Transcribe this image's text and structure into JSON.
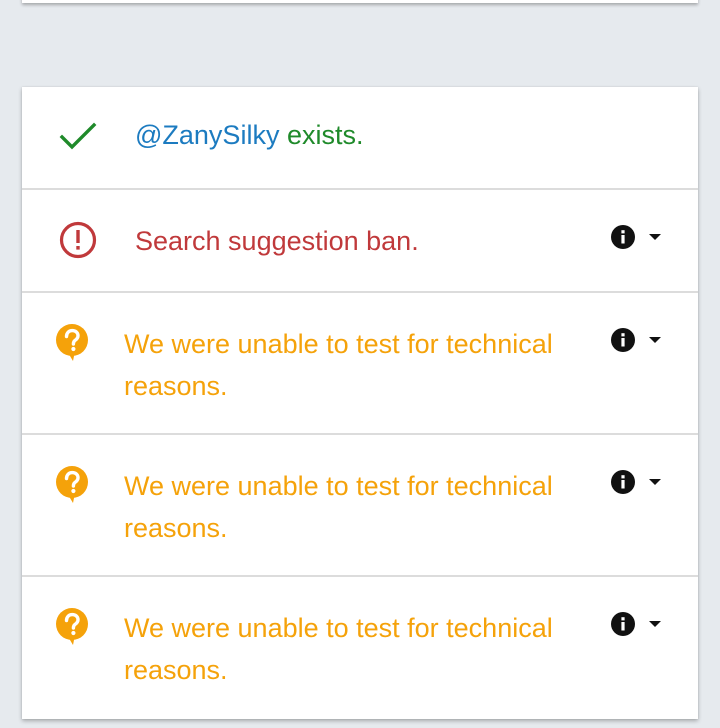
{
  "colors": {
    "background": "#e6eaee",
    "card": "#ffffff",
    "divider": "#dcdcdc",
    "success": "#1f8a2a",
    "handle": "#1c7bc0",
    "error": "#c0393b",
    "warning": "#f5a20a",
    "action_icon": "#111111"
  },
  "results": {
    "exists": {
      "icon": "checkmark-icon",
      "handle": "@ZanySilky",
      "text": " exists."
    },
    "suggestion_ban": {
      "icon": "alert-circle-icon",
      "text": "Search suggestion ban."
    },
    "unknown_tests": [
      {
        "icon": "question-bubble-icon",
        "text": "We were unable to test for technical reasons."
      },
      {
        "icon": "question-bubble-icon",
        "text": "We were unable to test for technical reasons."
      },
      {
        "icon": "question-bubble-icon",
        "text": "We were unable to test for technical reasons."
      }
    ]
  },
  "actions": {
    "info_icon": "info-icon",
    "dropdown_icon": "caret-down-icon"
  }
}
